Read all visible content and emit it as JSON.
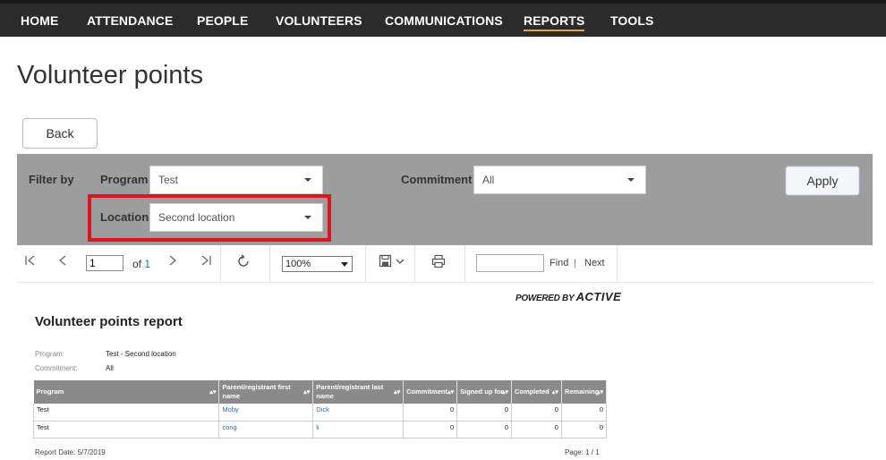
{
  "nav": {
    "items": [
      {
        "label": "HOME"
      },
      {
        "label": "ATTENDANCE"
      },
      {
        "label": "PEOPLE"
      },
      {
        "label": "VOLUNTEERS"
      },
      {
        "label": "COMMUNICATIONS"
      },
      {
        "label": "REPORTS",
        "active": true
      },
      {
        "label": "TOOLS"
      }
    ],
    "accent_color": "#e8a33a"
  },
  "page": {
    "title": "Volunteer points",
    "back_label": "Back"
  },
  "filter": {
    "filter_by_label": "Filter by",
    "program_label": "Program",
    "program_value": "Test",
    "commitment_label": "Commitment",
    "commitment_value": "All",
    "location_label": "Location",
    "location_value": "Second location",
    "apply_label": "Apply",
    "highlight_color": "#e0141e"
  },
  "toolbar": {
    "page_value": "1",
    "of_label": "of",
    "total_pages": "1",
    "zoom_value": "100%",
    "find_label": "Find",
    "find_sep": "|",
    "next_label": "Next",
    "icons": [
      "first-page-icon",
      "prev-page-icon",
      "next-page-icon",
      "last-page-icon",
      "refresh-icon",
      "save-icon",
      "print-icon"
    ]
  },
  "report": {
    "powered_prefix": "POWERED BY",
    "powered_brand": "ACTIVE",
    "title": "Volunteer points report",
    "meta": [
      {
        "label": "Program:",
        "value": "Test - Second location"
      },
      {
        "label": "Commitment:",
        "value": "All"
      }
    ],
    "columns": [
      "Program",
      "Parent/registrant first name",
      "Parent/registrant last name",
      "Commitment",
      "Signed up for",
      "Completed",
      "Remaining"
    ],
    "rows": [
      {
        "program": "Test",
        "first": "Moby",
        "last": "Dick",
        "commitment": "0",
        "signed": "0",
        "completed": "0",
        "remaining": "0"
      },
      {
        "program": "Test",
        "first": "cong",
        "last": "li",
        "commitment": "0",
        "signed": "0",
        "completed": "0",
        "remaining": "0"
      }
    ],
    "report_date": "Report Date: 5/7/2019",
    "page_info": "Page:  1 / 1"
  }
}
